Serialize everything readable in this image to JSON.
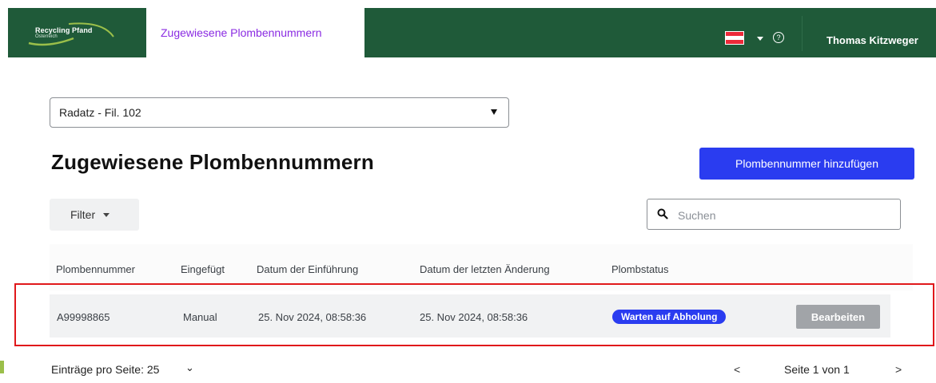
{
  "brand": {
    "line1": "Recycling Pfand",
    "line2": "Österreich"
  },
  "nav": {
    "active_tab": "Zugewiesene Plombennummern"
  },
  "header": {
    "user_name": "Thomas Kitzweger",
    "help_icon": "?",
    "user_chevron": "⌄",
    "flag_colors": [
      "#ed2939",
      "#ffffff",
      "#ed2939"
    ]
  },
  "store_select": {
    "value": "Radatz - Fil. 102"
  },
  "page": {
    "title": "Zugewiesene Plombennummern",
    "add_button": "Plombennummer hinzufügen"
  },
  "filter": {
    "label": "Filter"
  },
  "search": {
    "placeholder": "Suchen",
    "icon": "search-icon"
  },
  "table": {
    "headers": [
      "Plombennummer",
      "Eingefügt",
      "Datum der Einführung",
      "Datum der letzten Änderung",
      "Plombstatus"
    ],
    "rows": [
      {
        "number": "A99998865",
        "inserted": "Manual",
        "introduced": "25. Nov 2024, 08:58:36",
        "changed": "25. Nov 2024, 08:58:36",
        "status": "Warten auf Abholung",
        "action": "Bearbeiten"
      }
    ]
  },
  "pagination": {
    "per_page_label": "Einträge pro Seite: 25",
    "per_page_chevron": "⌄",
    "page_info": "Seite 1 von 1",
    "prev": "<",
    "next": ">"
  },
  "colors": {
    "header_bg": "#1f5a39",
    "accent": "#2a3cf0",
    "tab_text": "#8a2be2",
    "highlight": "#e0181b"
  }
}
